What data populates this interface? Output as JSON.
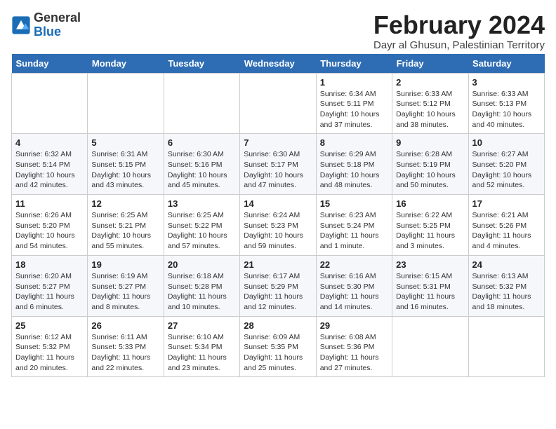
{
  "header": {
    "logo_line1": "General",
    "logo_line2": "Blue",
    "month_title": "February 2024",
    "subtitle": "Dayr al Ghusun, Palestinian Territory"
  },
  "days_of_week": [
    "Sunday",
    "Monday",
    "Tuesday",
    "Wednesday",
    "Thursday",
    "Friday",
    "Saturday"
  ],
  "weeks": [
    [
      {
        "day": "",
        "info": ""
      },
      {
        "day": "",
        "info": ""
      },
      {
        "day": "",
        "info": ""
      },
      {
        "day": "",
        "info": ""
      },
      {
        "day": "1",
        "info": "Sunrise: 6:34 AM\nSunset: 5:11 PM\nDaylight: 10 hours\nand 37 minutes."
      },
      {
        "day": "2",
        "info": "Sunrise: 6:33 AM\nSunset: 5:12 PM\nDaylight: 10 hours\nand 38 minutes."
      },
      {
        "day": "3",
        "info": "Sunrise: 6:33 AM\nSunset: 5:13 PM\nDaylight: 10 hours\nand 40 minutes."
      }
    ],
    [
      {
        "day": "4",
        "info": "Sunrise: 6:32 AM\nSunset: 5:14 PM\nDaylight: 10 hours\nand 42 minutes."
      },
      {
        "day": "5",
        "info": "Sunrise: 6:31 AM\nSunset: 5:15 PM\nDaylight: 10 hours\nand 43 minutes."
      },
      {
        "day": "6",
        "info": "Sunrise: 6:30 AM\nSunset: 5:16 PM\nDaylight: 10 hours\nand 45 minutes."
      },
      {
        "day": "7",
        "info": "Sunrise: 6:30 AM\nSunset: 5:17 PM\nDaylight: 10 hours\nand 47 minutes."
      },
      {
        "day": "8",
        "info": "Sunrise: 6:29 AM\nSunset: 5:18 PM\nDaylight: 10 hours\nand 48 minutes."
      },
      {
        "day": "9",
        "info": "Sunrise: 6:28 AM\nSunset: 5:19 PM\nDaylight: 10 hours\nand 50 minutes."
      },
      {
        "day": "10",
        "info": "Sunrise: 6:27 AM\nSunset: 5:20 PM\nDaylight: 10 hours\nand 52 minutes."
      }
    ],
    [
      {
        "day": "11",
        "info": "Sunrise: 6:26 AM\nSunset: 5:20 PM\nDaylight: 10 hours\nand 54 minutes."
      },
      {
        "day": "12",
        "info": "Sunrise: 6:25 AM\nSunset: 5:21 PM\nDaylight: 10 hours\nand 55 minutes."
      },
      {
        "day": "13",
        "info": "Sunrise: 6:25 AM\nSunset: 5:22 PM\nDaylight: 10 hours\nand 57 minutes."
      },
      {
        "day": "14",
        "info": "Sunrise: 6:24 AM\nSunset: 5:23 PM\nDaylight: 10 hours\nand 59 minutes."
      },
      {
        "day": "15",
        "info": "Sunrise: 6:23 AM\nSunset: 5:24 PM\nDaylight: 11 hours\nand 1 minute."
      },
      {
        "day": "16",
        "info": "Sunrise: 6:22 AM\nSunset: 5:25 PM\nDaylight: 11 hours\nand 3 minutes."
      },
      {
        "day": "17",
        "info": "Sunrise: 6:21 AM\nSunset: 5:26 PM\nDaylight: 11 hours\nand 4 minutes."
      }
    ],
    [
      {
        "day": "18",
        "info": "Sunrise: 6:20 AM\nSunset: 5:27 PM\nDaylight: 11 hours\nand 6 minutes."
      },
      {
        "day": "19",
        "info": "Sunrise: 6:19 AM\nSunset: 5:27 PM\nDaylight: 11 hours\nand 8 minutes."
      },
      {
        "day": "20",
        "info": "Sunrise: 6:18 AM\nSunset: 5:28 PM\nDaylight: 11 hours\nand 10 minutes."
      },
      {
        "day": "21",
        "info": "Sunrise: 6:17 AM\nSunset: 5:29 PM\nDaylight: 11 hours\nand 12 minutes."
      },
      {
        "day": "22",
        "info": "Sunrise: 6:16 AM\nSunset: 5:30 PM\nDaylight: 11 hours\nand 14 minutes."
      },
      {
        "day": "23",
        "info": "Sunrise: 6:15 AM\nSunset: 5:31 PM\nDaylight: 11 hours\nand 16 minutes."
      },
      {
        "day": "24",
        "info": "Sunrise: 6:13 AM\nSunset: 5:32 PM\nDaylight: 11 hours\nand 18 minutes."
      }
    ],
    [
      {
        "day": "25",
        "info": "Sunrise: 6:12 AM\nSunset: 5:32 PM\nDaylight: 11 hours\nand 20 minutes."
      },
      {
        "day": "26",
        "info": "Sunrise: 6:11 AM\nSunset: 5:33 PM\nDaylight: 11 hours\nand 22 minutes."
      },
      {
        "day": "27",
        "info": "Sunrise: 6:10 AM\nSunset: 5:34 PM\nDaylight: 11 hours\nand 23 minutes."
      },
      {
        "day": "28",
        "info": "Sunrise: 6:09 AM\nSunset: 5:35 PM\nDaylight: 11 hours\nand 25 minutes."
      },
      {
        "day": "29",
        "info": "Sunrise: 6:08 AM\nSunset: 5:36 PM\nDaylight: 11 hours\nand 27 minutes."
      },
      {
        "day": "",
        "info": ""
      },
      {
        "day": "",
        "info": ""
      }
    ]
  ]
}
